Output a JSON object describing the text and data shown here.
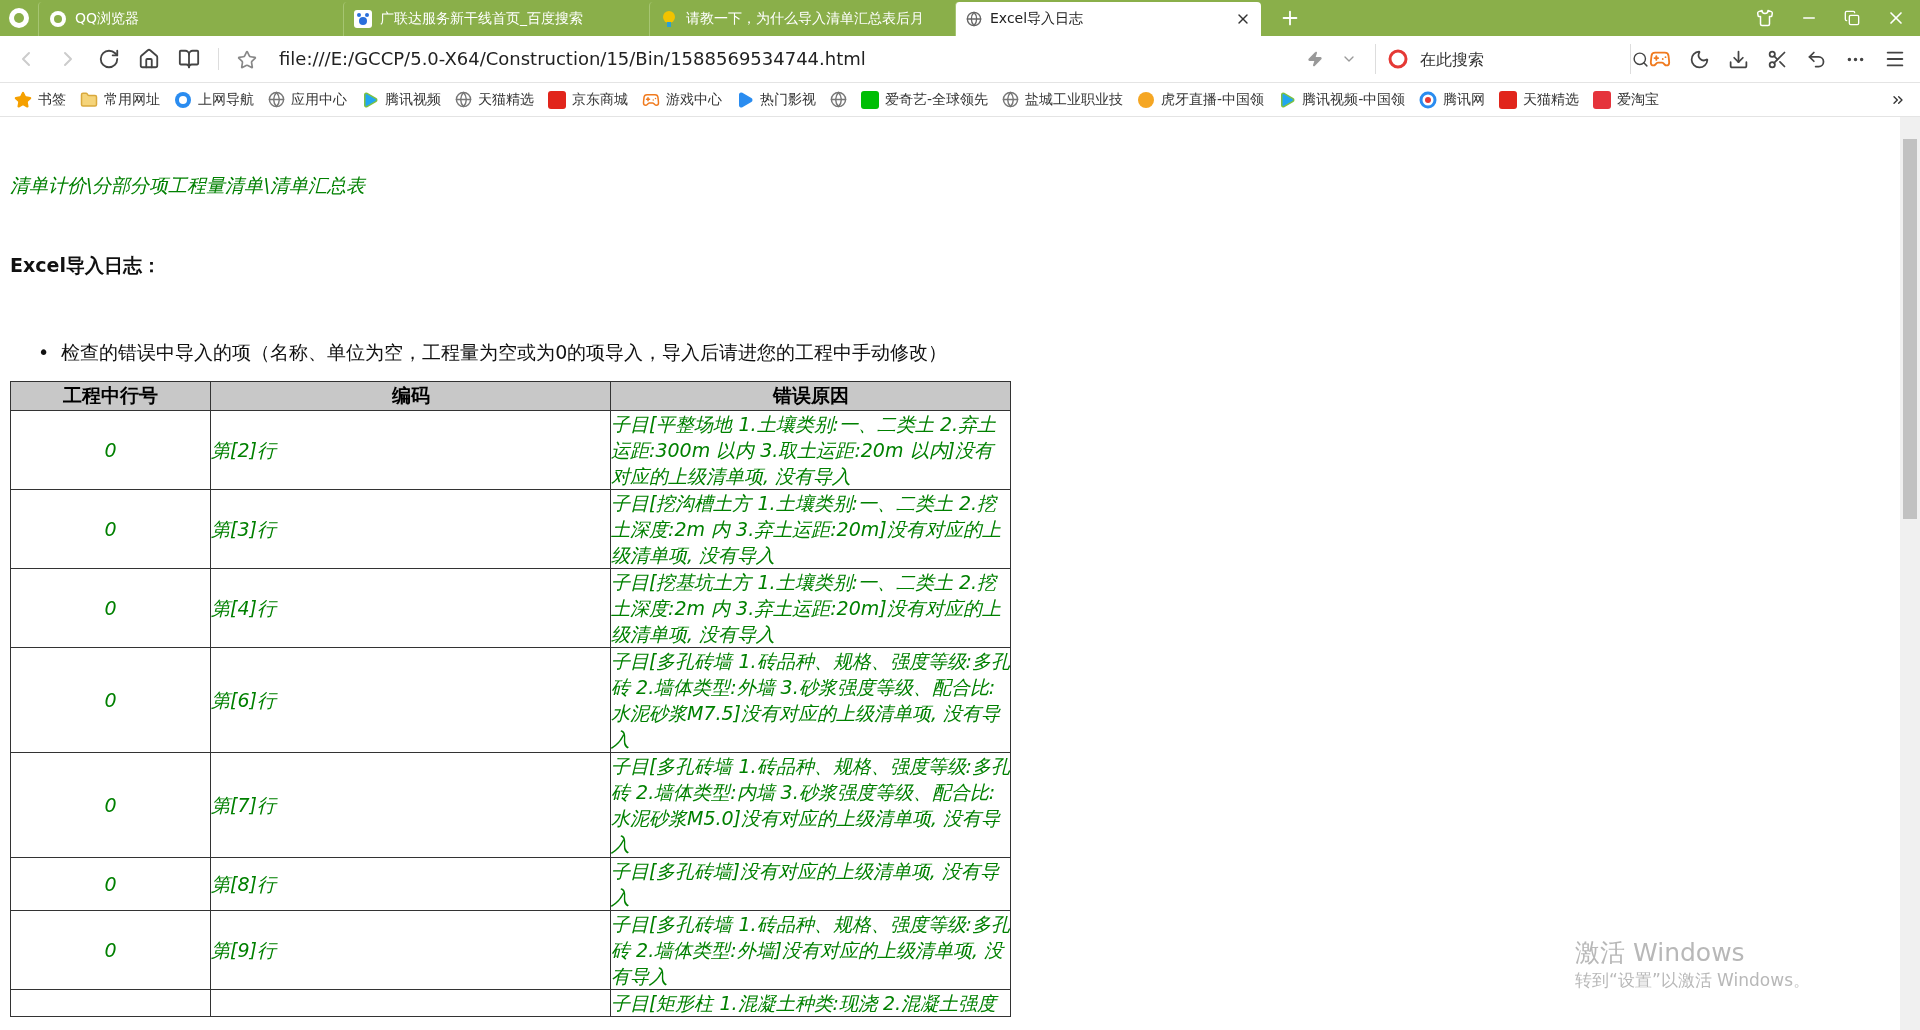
{
  "browser": {
    "tabs": [
      {
        "title": "QQ浏览器",
        "kind": "qq",
        "selected": false
      },
      {
        "title": "广联达服务新干线首页_百度搜索",
        "kind": "paw",
        "selected": false
      },
      {
        "title": "请教一下，为什么导入清单汇总表后月",
        "kind": "bulb",
        "selected": false
      },
      {
        "title": "Excel导入日志",
        "kind": "globe",
        "selected": true
      }
    ],
    "address": "file:///E:/GCCP/5.0-X64/Construction/15/Bin/1588569534744.html",
    "search": {
      "placeholder": "在此搜索"
    },
    "bookmarks": [
      {
        "label": "书签",
        "kind": "star"
      },
      {
        "label": "常用网址",
        "kind": "folder"
      },
      {
        "label": "上网导航",
        "kind": "qq"
      },
      {
        "label": "应用中心",
        "kind": "globe"
      },
      {
        "label": "腾讯视频",
        "kind": "play"
      },
      {
        "label": "天猫精选",
        "kind": "globe"
      },
      {
        "label": "京东商城",
        "kind": "jd"
      },
      {
        "label": "游戏中心",
        "kind": "game"
      },
      {
        "label": "热门影视",
        "kind": "film"
      },
      {
        "kind": "globe"
      },
      {
        "label": "爱奇艺-全球领先",
        "kind": "iqiyi"
      },
      {
        "label": "盐城工业职业技",
        "kind": "globe"
      },
      {
        "label": "虎牙直播-中国领",
        "kind": "huya"
      },
      {
        "label": "腾讯视频-中国领",
        "kind": "play"
      },
      {
        "label": "腾讯网",
        "kind": "qqnews"
      },
      {
        "label": "天猫精选",
        "kind": "tmall"
      },
      {
        "label": "爱淘宝",
        "kind": "taobao"
      }
    ]
  },
  "page": {
    "breadcrumb": "清单计价\\分部分项工程量清单\\清单汇总表",
    "heading": "Excel导入日志：",
    "bullet_marker": "•",
    "bullet": "检查的错误中导入的项（名称、单位为空，工程量为空或为0的项导入，导入后请进您的工程中手动修改）",
    "table": {
      "columns": [
        "工程中行号",
        "编码",
        "错误原因"
      ],
      "rows": [
        [
          "0",
          "第[2]行",
          "子目[平整场地 1.土壤类别:一、二类土 2.弃土运距:300m 以内 3.取土运距:20m 以内]没有对应的上级清单项, 没有导入"
        ],
        [
          "0",
          "第[3]行",
          "子目[挖沟槽土方 1.土壤类别:一、二类土 2.挖土深度:2m 内 3.弃土运距:20m]没有对应的上级清单项, 没有导入"
        ],
        [
          "0",
          "第[4]行",
          "子目[挖基坑土方 1.土壤类别:一、二类土 2.挖土深度:2m 内 3.弃土运距:20m]没有对应的上级清单项, 没有导入"
        ],
        [
          "0",
          "第[6]行",
          "子目[多孔砖墙 1.砖品种、规格、强度等级:多孔砖 2.墙体类型:外墙 3.砂浆强度等级、配合比:水泥砂浆M7.5]没有对应的上级清单项, 没有导入"
        ],
        [
          "0",
          "第[7]行",
          "子目[多孔砖墙 1.砖品种、规格、强度等级:多孔砖 2.墙体类型:内墙 3.砂浆强度等级、配合比:水泥砂浆M5.0]没有对应的上级清单项, 没有导入"
        ],
        [
          "0",
          "第[8]行",
          "子目[多孔砖墙]没有对应的上级清单项, 没有导入"
        ],
        [
          "0",
          "第[9]行",
          "子目[多孔砖墙 1.砖品种、规格、强度等级:多孔砖 2.墙体类型:外墙]没有对应的上级清单项, 没有导入"
        ],
        [
          "",
          "",
          "子目[矩形柱 1.混凝土种类:现浇 2.混凝土强度"
        ]
      ]
    }
  },
  "watermark": {
    "title": "激活 Windows",
    "subtitle": "转到“设置”以激活 Windows。"
  }
}
